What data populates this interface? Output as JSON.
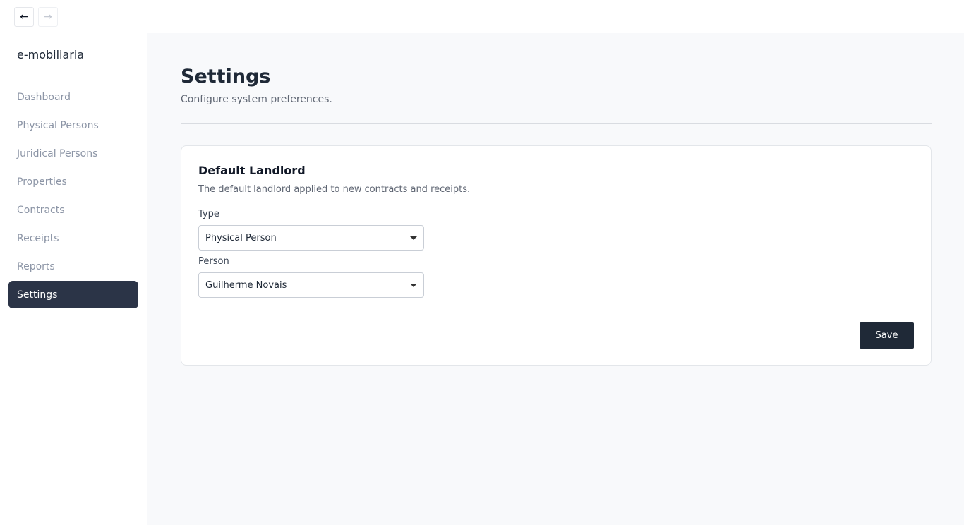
{
  "toolbar": {
    "back_icon": "arrow-left-icon",
    "forward_icon": "arrow-right-icon"
  },
  "sidebar": {
    "brand": "e-mobiliaria",
    "items": [
      {
        "label": "Dashboard"
      },
      {
        "label": "Physical Persons"
      },
      {
        "label": "Juridical Persons"
      },
      {
        "label": "Properties"
      },
      {
        "label": "Contracts"
      },
      {
        "label": "Receipts"
      },
      {
        "label": "Reports"
      },
      {
        "label": "Settings",
        "active": true
      }
    ]
  },
  "page": {
    "title": "Settings",
    "subtitle": "Configure system preferences."
  },
  "landlord": {
    "title": "Default Landlord",
    "description": "The default landlord applied to new contracts and receipts.",
    "type_label": "Type",
    "type_value": "Physical Person",
    "person_label": "Person",
    "person_value": "Guilherme Novais",
    "save_label": "Save"
  },
  "colors": {
    "accent": "#1f2937",
    "active_nav": "#2b3447",
    "background": "#f8f9fb"
  }
}
